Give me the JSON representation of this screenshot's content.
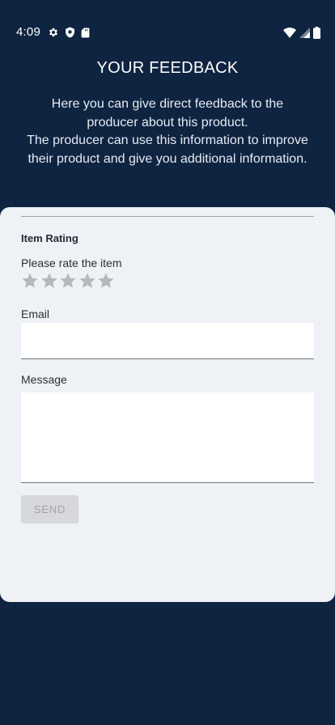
{
  "status_bar": {
    "time": "4:09",
    "left_icons": [
      "gear-icon",
      "shield-icon",
      "sd-card-icon"
    ],
    "right_icons": [
      "wifi-icon",
      "signal-icon",
      "battery-icon"
    ]
  },
  "header": {
    "title": "YOUR FEEDBACK",
    "intro_line1": "Here you can give direct feedback to the producer about this product.",
    "intro_line2": "The producer can use this information to improve their product and give you additional information."
  },
  "form": {
    "section_title": "Item Rating",
    "rating_label": "Please rate the item",
    "rating": {
      "value": 0,
      "max": 5
    },
    "email_label": "Email",
    "email_value": "",
    "message_label": "Message",
    "message_value": "",
    "send_label": "SEND"
  },
  "colors": {
    "background": "#0e2441",
    "card": "#eef2f6",
    "star_inactive": "#b5b8bd",
    "button_disabled": "#d6d8db"
  }
}
